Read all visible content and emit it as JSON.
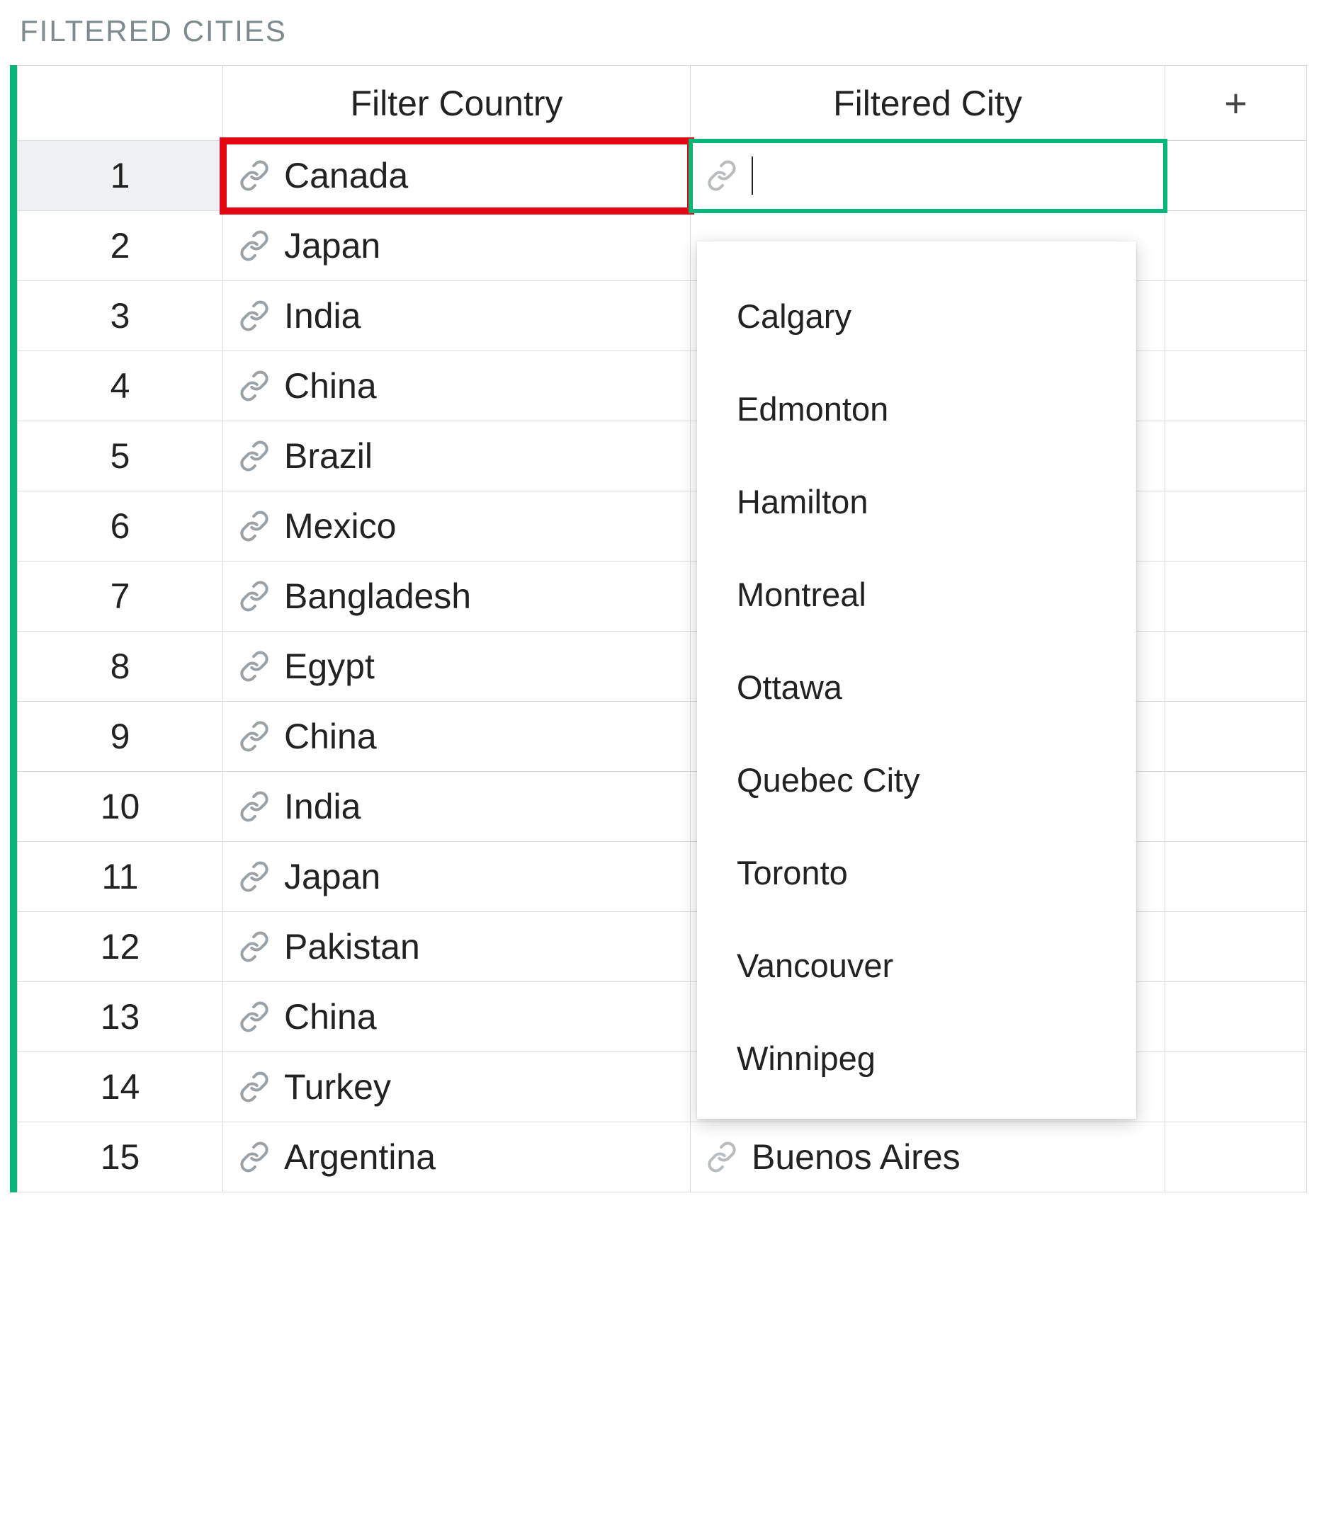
{
  "section_title": "FILTERED CITIES",
  "columns": {
    "country": "Filter Country",
    "city": "Filtered City",
    "add": "+"
  },
  "rows": [
    {
      "num": "1",
      "country": "Canada",
      "city": ""
    },
    {
      "num": "2",
      "country": "Japan",
      "city": ""
    },
    {
      "num": "3",
      "country": "India",
      "city": ""
    },
    {
      "num": "4",
      "country": "China",
      "city": ""
    },
    {
      "num": "5",
      "country": "Brazil",
      "city": ""
    },
    {
      "num": "6",
      "country": "Mexico",
      "city": ""
    },
    {
      "num": "7",
      "country": "Bangladesh",
      "city": ""
    },
    {
      "num": "8",
      "country": "Egypt",
      "city": ""
    },
    {
      "num": "9",
      "country": "China",
      "city": ""
    },
    {
      "num": "10",
      "country": "India",
      "city": ""
    },
    {
      "num": "11",
      "country": "Japan",
      "city": ""
    },
    {
      "num": "12",
      "country": "Pakistan",
      "city": ""
    },
    {
      "num": "13",
      "country": "China",
      "city": ""
    },
    {
      "num": "14",
      "country": "Turkey",
      "city": ""
    },
    {
      "num": "15",
      "country": "Argentina",
      "city": "Buenos Aires"
    }
  ],
  "dropdown": {
    "options": [
      "Calgary",
      "Edmonton",
      "Hamilton",
      "Montreal",
      "Ottawa",
      "Quebec City",
      "Toronto",
      "Vancouver",
      "Winnipeg"
    ]
  },
  "colors": {
    "accent_green": "#0ab57a",
    "highlight_red": "#e30613"
  }
}
